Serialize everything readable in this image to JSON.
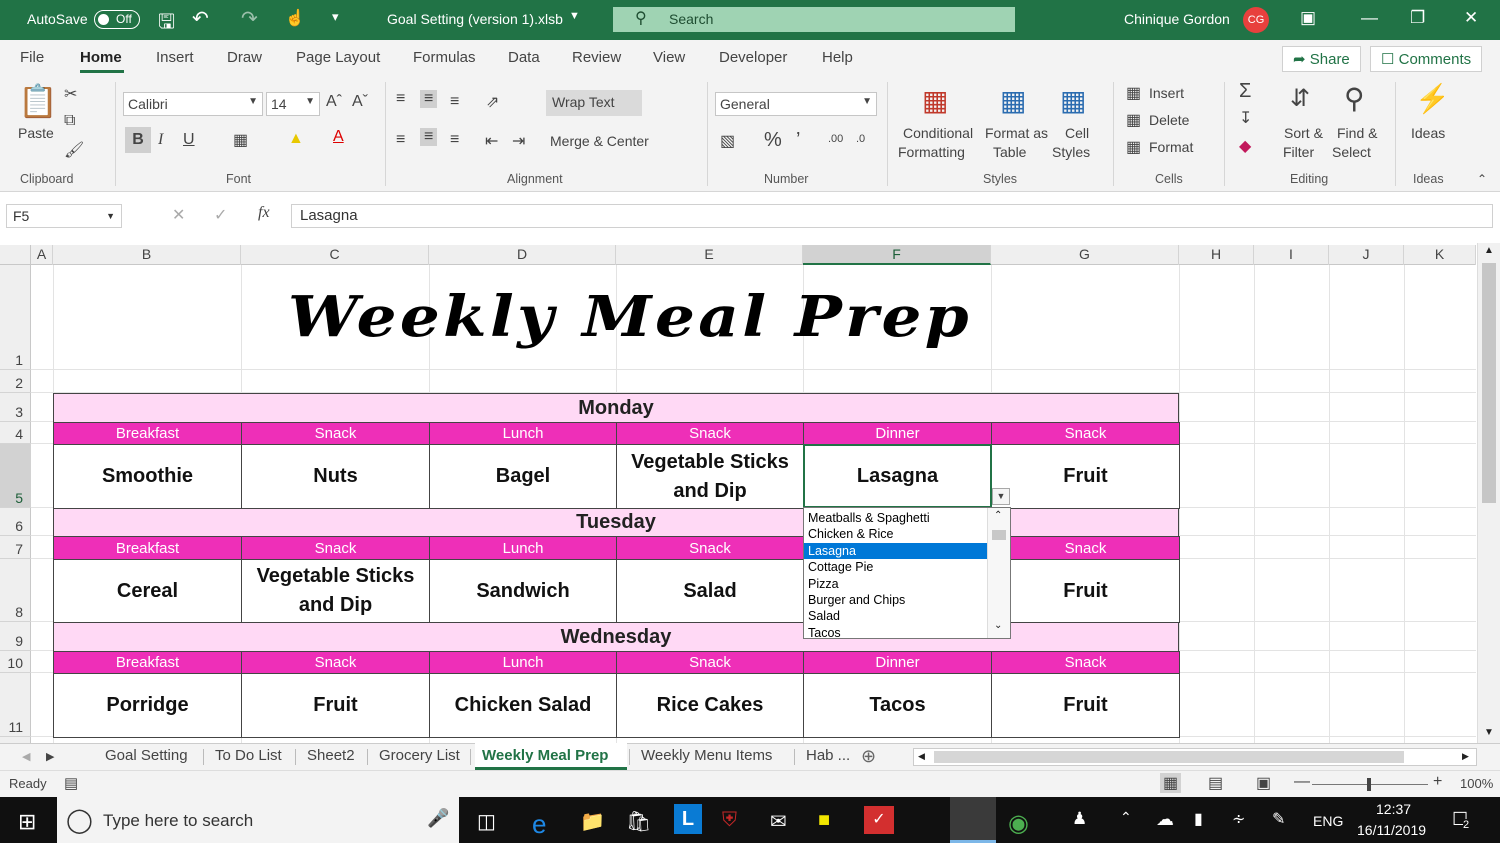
{
  "titlebar": {
    "autosave": "AutoSave",
    "toggle": "Off",
    "filename": "Goal Setting  (version 1).xlsb",
    "search": "Search",
    "user": "Chinique Gordon",
    "initials": "CG"
  },
  "menu": {
    "file": "File",
    "home": "Home",
    "insert": "Insert",
    "draw": "Draw",
    "page_layout": "Page Layout",
    "formulas": "Formulas",
    "data": "Data",
    "review": "Review",
    "view": "View",
    "developer": "Developer",
    "help": "Help",
    "share": "Share",
    "comments": "Comments"
  },
  "ribbon": {
    "paste": "Paste",
    "font_name": "Calibri",
    "font_size": "14",
    "wrap_text": "Wrap Text",
    "merge_center": "Merge & Center",
    "number_format": "General",
    "cond_fmt1": "Conditional",
    "cond_fmt2": "Formatting",
    "fmt_table1": "Format as",
    "fmt_table2": "Table",
    "cell_styles1": "Cell",
    "cell_styles2": "Styles",
    "insert": "Insert",
    "delete": "Delete",
    "format": "Format",
    "sort1": "Sort &",
    "sort2": "Filter",
    "find1": "Find &",
    "find2": "Select",
    "ideas": "Ideas",
    "groups": {
      "clipboard": "Clipboard",
      "font": "Font",
      "alignment": "Alignment",
      "number": "Number",
      "styles": "Styles",
      "cells": "Cells",
      "editing": "Editing",
      "ideas": "Ideas"
    }
  },
  "formula": {
    "namebox": "F5",
    "content": "Lasagna"
  },
  "columns": [
    "A",
    "B",
    "C",
    "D",
    "E",
    "F",
    "G",
    "H",
    "I",
    "J",
    "K"
  ],
  "rows": [
    "1",
    "2",
    "3",
    "4",
    "5",
    "6",
    "7",
    "8",
    "9",
    "10",
    "11"
  ],
  "sheet_title": "Weekly Meal Prep",
  "meals": [
    "Breakfast",
    "Snack",
    "Lunch",
    "Snack",
    "Dinner",
    "Snack"
  ],
  "days": [
    {
      "name": "Monday",
      "foods": [
        "Smoothie",
        "Nuts",
        "Bagel",
        "Vegetable Sticks and Dip",
        "Lasagna",
        "Fruit"
      ]
    },
    {
      "name": "Tuesday",
      "foods": [
        "Cereal",
        "Vegetable Sticks and Dip",
        "Sandwich",
        "Salad",
        "",
        "Fruit"
      ]
    },
    {
      "name": "Wednesday",
      "foods": [
        "Porridge",
        "Fruit",
        "Chicken Salad",
        "Rice Cakes",
        "Tacos",
        "Fruit"
      ]
    }
  ],
  "dropdown": {
    "options": [
      "Meatballs & Spaghetti",
      "Chicken & Rice",
      "Lasagna",
      "Cottage Pie",
      "Pizza",
      "Burger and Chips",
      "Salad",
      "Tacos"
    ],
    "selected": "Lasagna"
  },
  "sheets": [
    "Goal Setting",
    "To Do List",
    "Sheet2",
    "Grocery List",
    "Weekly Meal Prep",
    "Weekly Menu Items",
    "Hab ..."
  ],
  "status": {
    "ready": "Ready",
    "zoom": "100%"
  },
  "taskbar": {
    "search": "Type here to search",
    "lang": "ENG",
    "time": "12:37",
    "date": "16/11/2019",
    "notif": "2"
  },
  "colors": {
    "excel_green": "#217346",
    "day_bg": "#ffd9f5",
    "meal_bg": "#ee2fb8",
    "highlight": "#0078d7"
  }
}
